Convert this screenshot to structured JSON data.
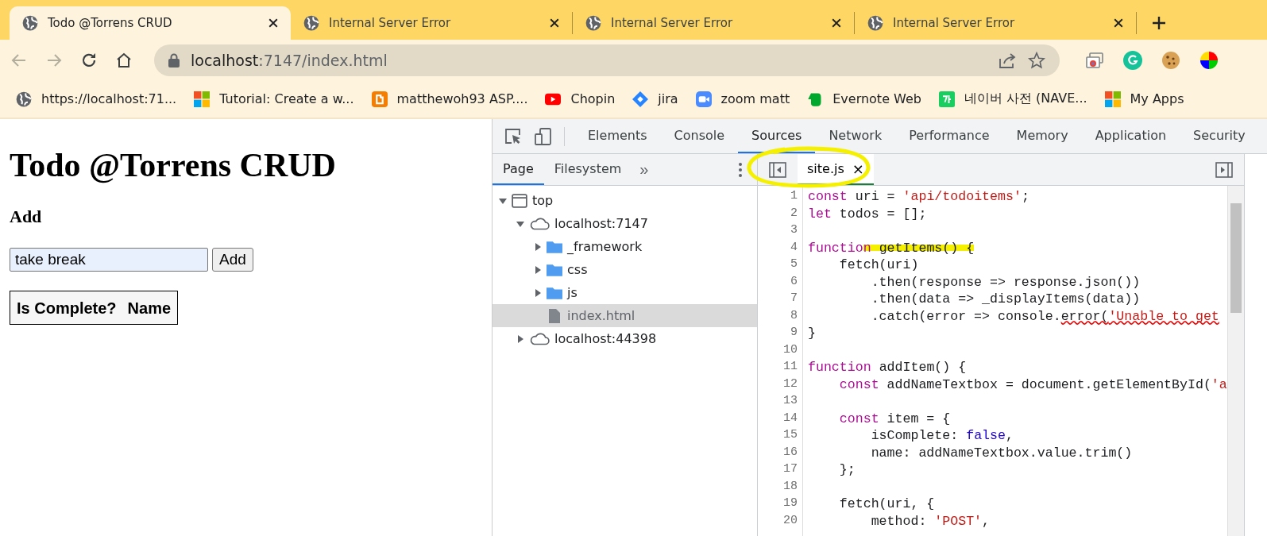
{
  "browser_tabs": [
    {
      "title": "Todo @Torrens CRUD",
      "selected": true
    },
    {
      "title": "Internal Server Error",
      "selected": false
    },
    {
      "title": "Internal Server Error",
      "selected": false
    },
    {
      "title": "Internal Server Error",
      "selected": false
    }
  ],
  "address_bar": {
    "host": "localhost",
    "path": ":7147/index.html"
  },
  "bookmarks": [
    {
      "label": "https://localhost:71...",
      "kind": "globe"
    },
    {
      "label": "Tutorial: Create a w...",
      "kind": "windows"
    },
    {
      "label": "matthewoh93 ASP....",
      "kind": "blogger"
    },
    {
      "label": "Chopin",
      "kind": "youtube"
    },
    {
      "label": "jira",
      "kind": "jira"
    },
    {
      "label": "zoom matt",
      "kind": "zoom"
    },
    {
      "label": "Evernote Web",
      "kind": "evernote"
    },
    {
      "label": "네이버 사전 (NAVE...",
      "kind": "naver"
    },
    {
      "label": "My Apps",
      "kind": "windows"
    }
  ],
  "page": {
    "title": "Todo @Torrens CRUD",
    "add_heading": "Add",
    "name_field": {
      "value": "take break"
    },
    "add_button": "Add",
    "table": {
      "columns": [
        "Is Complete?",
        "Name"
      ]
    }
  },
  "devtools": {
    "tabs": [
      {
        "label": "Elements",
        "selected": false
      },
      {
        "label": "Console",
        "selected": false
      },
      {
        "label": "Sources",
        "selected": true
      },
      {
        "label": "Network",
        "selected": false
      },
      {
        "label": "Performance",
        "selected": false
      },
      {
        "label": "Memory",
        "selected": false
      },
      {
        "label": "Application",
        "selected": false
      },
      {
        "label": "Security",
        "selected": false
      }
    ],
    "navigator_tabs": [
      {
        "label": "Page",
        "selected": true
      },
      {
        "label": "Filesystem",
        "selected": false
      }
    ],
    "overflow": "»",
    "tree": [
      {
        "label": "top",
        "kind": "frame",
        "expanded": true,
        "selected": false,
        "children": [
          {
            "label": "localhost:7147",
            "kind": "origin",
            "expanded": true,
            "selected": false,
            "children": [
              {
                "label": "_framework",
                "kind": "folder",
                "expanded": false,
                "selected": false
              },
              {
                "label": "css",
                "kind": "folder",
                "expanded": false,
                "selected": false
              },
              {
                "label": "js",
                "kind": "folder",
                "expanded": false,
                "selected": false
              },
              {
                "label": "index.html",
                "kind": "file",
                "selected": true
              }
            ]
          },
          {
            "label": "localhost:44398",
            "kind": "origin",
            "expanded": false,
            "selected": false
          }
        ]
      }
    ],
    "file_tab": {
      "label": "site.js",
      "close": "×"
    },
    "code": [
      {
        "number": "1",
        "tokens": [
          {
            "text": "const",
            "kind": "keyword"
          },
          {
            "text": " uri = ",
            "kind": "plain"
          },
          {
            "text": "'api/todoitems'",
            "kind": "string"
          },
          {
            "text": ";",
            "kind": "plain"
          }
        ]
      },
      {
        "number": "2",
        "tokens": [
          {
            "text": "let",
            "kind": "keyword"
          },
          {
            "text": " todos = [];",
            "kind": "plain"
          }
        ]
      },
      {
        "number": "3"
      },
      {
        "number": "4",
        "tokens": [
          {
            "text": "functio",
            "kind": "keyword"
          },
          {
            "text": "n",
            "kind": "keyword",
            "highlighted": true
          },
          {
            "text": " getItems() {",
            "kind": "plain",
            "highlighted": true
          }
        ]
      },
      {
        "number": "5",
        "tokens": [
          {
            "text": "    fetch(uri)",
            "kind": "plain"
          }
        ]
      },
      {
        "number": "6",
        "tokens": [
          {
            "text": "        .then(response => response.json())",
            "kind": "plain"
          }
        ]
      },
      {
        "number": "7",
        "tokens": [
          {
            "text": "        .then(data => _displayItems(data))",
            "kind": "plain"
          }
        ]
      },
      {
        "number": "8",
        "tokens": [
          {
            "text": "        .catch(error => console.",
            "kind": "plain"
          },
          {
            "text": "error(",
            "kind": "plain",
            "squiggle": true
          },
          {
            "text": "'Unable to get",
            "kind": "string",
            "squiggle": true
          }
        ]
      },
      {
        "number": "9",
        "tokens": [
          {
            "text": "}",
            "kind": "plain"
          }
        ]
      },
      {
        "number": "10"
      },
      {
        "number": "11",
        "tokens": [
          {
            "text": "function",
            "kind": "keyword"
          },
          {
            "text": " addItem() {",
            "kind": "plain"
          }
        ]
      },
      {
        "number": "12",
        "tokens": [
          {
            "text": "    const",
            "kind": "keyword"
          },
          {
            "text": " addNameTextbox = document.getElementById(",
            "kind": "plain"
          },
          {
            "text": "'a",
            "kind": "string"
          }
        ]
      },
      {
        "number": "13"
      },
      {
        "number": "14",
        "tokens": [
          {
            "text": "    const",
            "kind": "keyword"
          },
          {
            "text": " item = {",
            "kind": "plain"
          }
        ]
      },
      {
        "number": "15",
        "tokens": [
          {
            "text": "        isComplete: ",
            "kind": "plain"
          },
          {
            "text": "false",
            "kind": "literal"
          },
          {
            "text": ",",
            "kind": "plain"
          }
        ]
      },
      {
        "number": "16",
        "tokens": [
          {
            "text": "        name: addNameTextbox.value.trim()",
            "kind": "plain"
          }
        ]
      },
      {
        "number": "17",
        "tokens": [
          {
            "text": "    };",
            "kind": "plain"
          }
        ]
      },
      {
        "number": "18"
      },
      {
        "number": "19",
        "tokens": [
          {
            "text": "    fetch(uri, {",
            "kind": "plain"
          }
        ]
      },
      {
        "number": "20",
        "tokens": [
          {
            "text": "        method: ",
            "kind": "plain"
          },
          {
            "text": "'POST'",
            "kind": "string"
          },
          {
            "text": ",",
            "kind": "plain"
          }
        ]
      }
    ]
  }
}
